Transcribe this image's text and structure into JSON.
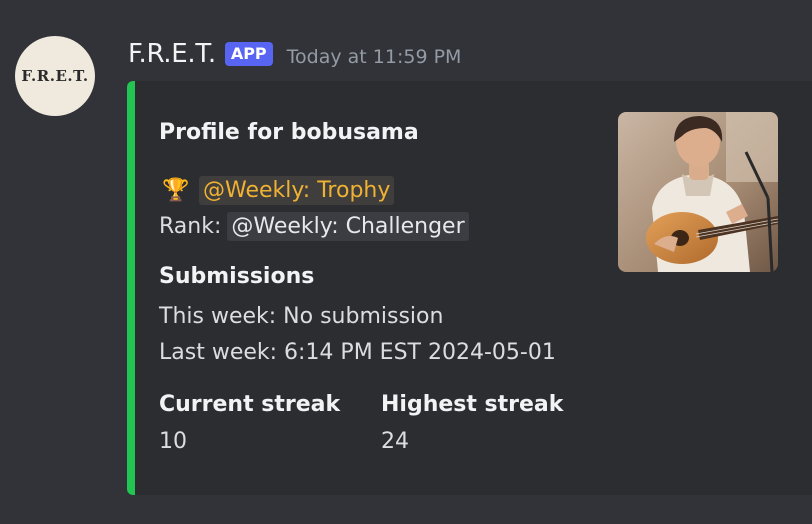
{
  "author": {
    "avatar_text": "F.R.E.T.",
    "name": "F.R.E.T.",
    "badge": "APP",
    "timestamp": "Today at 11:59 PM"
  },
  "embed": {
    "accent_color": "#23c552",
    "title": "Profile for bobusama",
    "trophy_icon": "trophy-icon",
    "trophy_emoji": "🏆",
    "trophy_role": "@Weekly: Trophy",
    "rank_label": "Rank:",
    "rank_role": "@Weekly: Challenger",
    "submissions_title": "Submissions",
    "this_week": "This week: No submission",
    "last_week": "Last week: 6:14 PM EST 2024-05-01",
    "fields": [
      {
        "name": "Current streak",
        "value": "10"
      },
      {
        "name": "Highest streak",
        "value": "24"
      }
    ]
  },
  "colors": {
    "background": "#313338",
    "embed_background": "#2b2d31",
    "app_badge": "#5865f2",
    "trophy_role": "#f0b232"
  }
}
